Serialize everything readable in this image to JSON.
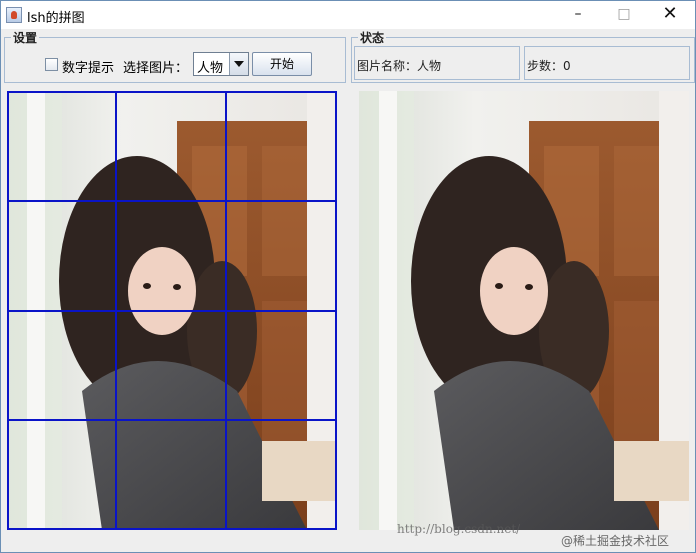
{
  "window": {
    "title": "lsh的拼图",
    "minimize_glyph": "–",
    "maximize_glyph": "□",
    "close_glyph": "✕"
  },
  "settings": {
    "title": "设置",
    "number_hint_label": "数字提示",
    "number_hint_checked": false,
    "select_image_label": "选择图片：",
    "image_selected": "人物",
    "start_label": "开始"
  },
  "status": {
    "title": "状态",
    "image_name": "图片名称：人物",
    "steps": "步数：0"
  },
  "puzzle": {
    "rows": 4,
    "cols": 3,
    "grid_color": "#0a14c8"
  },
  "watermark": {
    "url": "http://blog.csdn.net/",
    "community": "@稀土掘金技术社区"
  },
  "colors": {
    "window_bg": "#eeeeee",
    "border": "#a8bcd3",
    "accent": "#0a14c8"
  }
}
